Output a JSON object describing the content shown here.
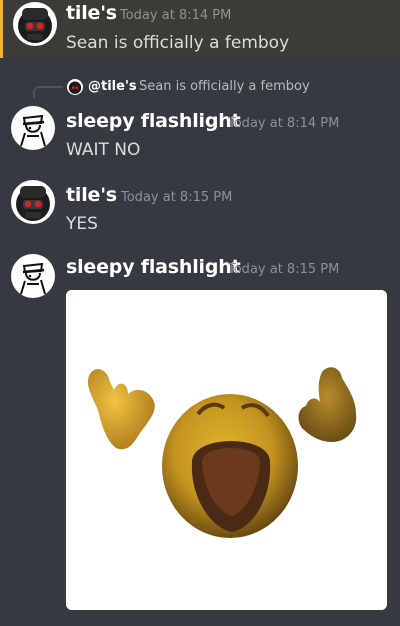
{
  "colors": {
    "background": "#36393f",
    "highlight_background": "#3c3b36",
    "highlight_border": "#f0b232",
    "username": "#ffffff",
    "message_text": "#dcddde",
    "timestamp": "#8e9297"
  },
  "messages": [
    {
      "author": "tile's",
      "time": "Today at 8:14 PM",
      "text": "Sean is officially a femboy",
      "avatar_icon": "red-eyed-helmet-avatar-icon",
      "highlighted": true
    },
    {
      "reply": {
        "author": "@tile's",
        "text": "Sean is officially a femboy",
        "avatar_icon": "red-eyed-helmet-avatar-icon"
      },
      "author": "sleepy flashlight",
      "time": "Today at 8:14 PM",
      "text": "WAIT NO",
      "avatar_icon": "sketch-character-avatar-icon"
    },
    {
      "author": "tile's",
      "time": "Today at 8:15 PM",
      "text": "YES",
      "avatar_icon": "red-eyed-helmet-avatar-icon"
    },
    {
      "author": "sleepy flashlight",
      "time": "Today at 8:15 PM",
      "avatar_icon": "sketch-character-avatar-icon",
      "attachment": {
        "kind": "image",
        "subject": "screaming-emoji-with-raised-hands-image"
      }
    }
  ]
}
